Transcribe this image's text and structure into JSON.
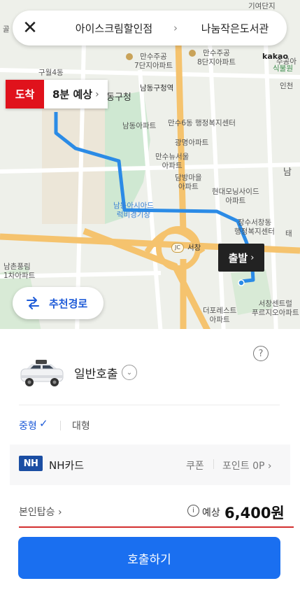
{
  "route": {
    "from": "아이스크림할인점",
    "to": "나눔작은도서관",
    "arrow": "›"
  },
  "map": {
    "arrival_tag": "도착",
    "arrival_eta": "8분 예상",
    "departure_tag": "출발",
    "recommend_label": "추천경로",
    "attribution": "kakao",
    "labels": {
      "guwol": "구월4동",
      "mansu7": "만수주공\n7단지아파트",
      "mansu8": "만수주공\n8단지아파트",
      "namdong_office": "남동구청역",
      "namdong_gu": "동구청",
      "namdong_apt": "남동아파트",
      "mansu6": "만수6동\n행정복지센터",
      "gwangmyeong": "광명아파트",
      "mansu_new": "만수뉴서울\n아파트",
      "dambang": "담방마을\n아파트",
      "hyundai": "현대모닝사이드\n아파트",
      "asiad": "남동아시아드\n럭비경기장",
      "jangsu": "장수서창동\n행정복지센터",
      "seochang_jc": "서창",
      "jc": "JC",
      "namchon": "남촌풍림\n1차아파트",
      "forest": "더포레스트\n아파트",
      "central": "서창센트럴\n푸르지오아파트",
      "suwon": "수공아",
      "market": "식물원",
      "incheon": "인천",
      "nam": "남",
      "tae": "태",
      "golf": "골",
      "top_right": "기여단지"
    }
  },
  "sheet": {
    "help_icon": "?",
    "service_name": "일반호출",
    "type_medium": "중형",
    "type_large": "대형",
    "card_logo": "NH",
    "card_name": "NH카드",
    "coupon": "쿠폰",
    "points": "포인트 0P",
    "self_ride": "본인탑승",
    "fare_label": "예상",
    "fare_value": "6,400원",
    "call_button": "호출하기"
  },
  "colors": {
    "route_line": "#2b8be6",
    "arrival_red": "#e0121c",
    "call_button_blue": "#1a6ff0",
    "selected_blue": "#1e5bd8",
    "road_orange": "#f5c36e"
  }
}
